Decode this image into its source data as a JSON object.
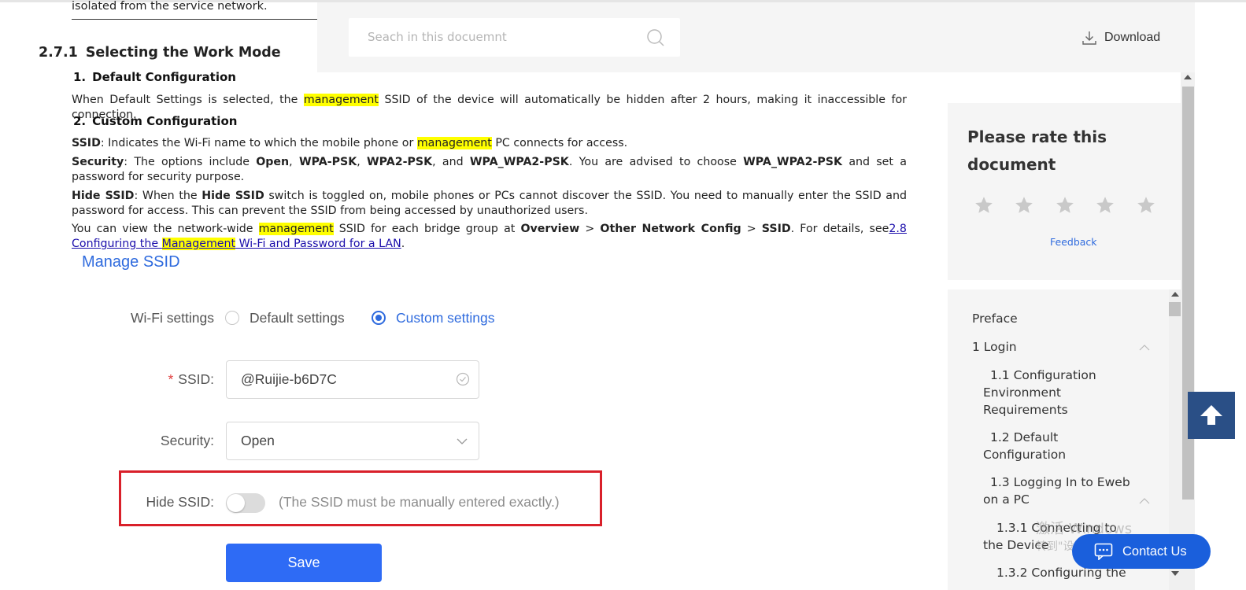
{
  "search": {
    "placeholder": "Seach in this docuemnt"
  },
  "header": {
    "download_label": "Download"
  },
  "doc": {
    "prev_line": "isolated from the service network.",
    "section_num": "2.7.1",
    "section_title": "Selecting the Work Mode",
    "sub1_num": "1.",
    "sub1_title": "Default Configuration",
    "p1": {
      "a": "When Default Settings is selected, the ",
      "hl": "management",
      "b": " SSID of the device will automatically be hidden after 2 hours, making it inaccessible for connection."
    },
    "sub2_num": "2.",
    "sub2_title": "Custom Configuration",
    "p2": {
      "term": "SSID",
      "a": ": Indicates the Wi-Fi name to which the mobile phone or ",
      "hl": "management",
      "b": " PC connects for access."
    },
    "p3": {
      "term": "Security",
      "a": ": The options include ",
      "o1": "Open",
      "s1": ", ",
      "o2": "WPA-PSK",
      "s2": ", ",
      "o3": "WPA2-PSK",
      "s3": ", and ",
      "o4": "WPA_WPA2-PSK",
      "s4": ". You are advised to choose ",
      "o5": "WPA_WPA2-PSK",
      "s5": " and set a password for security purpose."
    },
    "p4": {
      "term": "Hide SSID",
      "a": ": When the ",
      "term2": "Hide SSID",
      "b": " switch is toggled on, mobile phones or PCs cannot discover the SSID. You need to manually enter the SSID and password for access. This can prevent the SSID from being accessed by unauthorized users."
    },
    "p5": {
      "a": "You can view the network-wide ",
      "hl": "management",
      "b": " SSID for each bridge group at ",
      "n1": "Overview",
      "g1": " > ",
      "n2": "Other Network Config",
      "g2": " > ",
      "n3": "SSID",
      "c": ". For details, see",
      "link_a": "2.8   Configuring the ",
      "link_hl": "Management",
      "link_b": " Wi-Fi and Password for a LAN",
      "end": "."
    }
  },
  "figure": {
    "title": "Manage SSID",
    "wifi_label": "Wi-Fi settings",
    "opt_default": "Default settings",
    "opt_custom": "Custom settings",
    "selected": "Custom settings",
    "required_mark": "*",
    "ssid_label": "SSID:",
    "ssid_value": "@Ruijie-b6D7C",
    "security_label": "Security:",
    "security_value": "Open",
    "hide_label": "Hide SSID:",
    "hide_on": false,
    "hide_hint": "(The SSID must be manually entered exactly.)",
    "save_label": "Save"
  },
  "rating": {
    "title": "Please rate this document",
    "stars": 5,
    "selected": 0,
    "feedback_label": "Feedback"
  },
  "toc": {
    "items": [
      {
        "label": "Preface"
      },
      {
        "label": "1 Login"
      },
      {
        "label": "1.1 Configuration Environment Requirements"
      },
      {
        "label": "1.2 Default Configuration"
      },
      {
        "label": "1.3 Logging In to Eweb on a PC"
      },
      {
        "label": "1.3.1 Connecting to the Device"
      },
      {
        "label": "1.3.2 Configuring the"
      }
    ]
  },
  "contact": {
    "label": "Contact Us"
  },
  "watermark": {
    "line1": "激活 Windows",
    "line2": "转到\"设置\"以激活 Windows。"
  },
  "colors": {
    "accent": "#2f6bde",
    "highlight": "#ffff00",
    "callout": "#d9202a",
    "save_button": "#2e6bf5",
    "contact_button": "#1a5fdc",
    "back_to_top": "#2a4f86"
  }
}
